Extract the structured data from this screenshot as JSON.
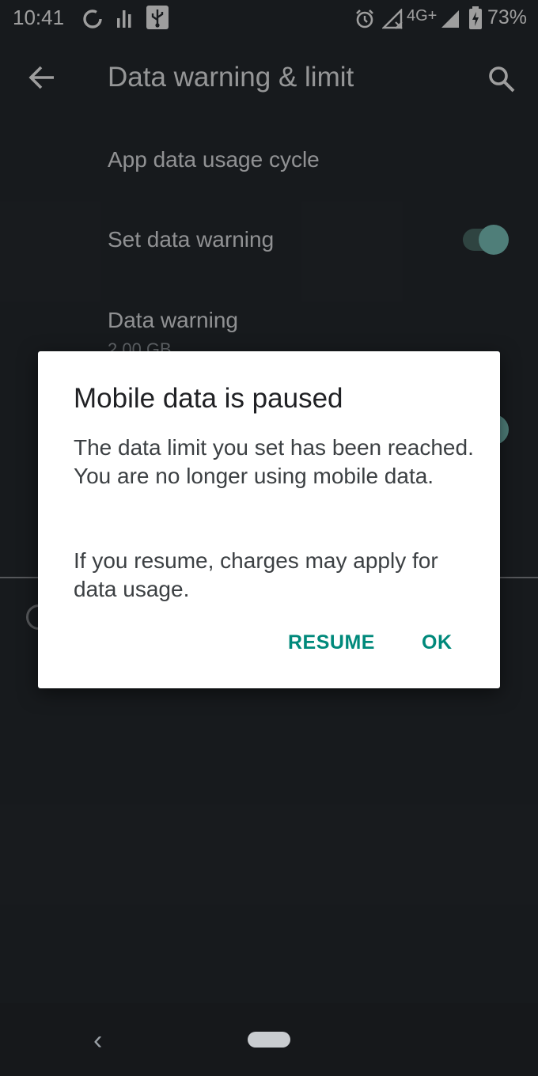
{
  "status_bar": {
    "time": "10:41",
    "network_type": "4G+",
    "battery_percent": "73%",
    "icons": [
      "sync-icon",
      "signal-bars-icon",
      "usb-icon",
      "alarm-icon",
      "no-signal-icon",
      "cell-signal-icon",
      "battery-charging-icon"
    ]
  },
  "app_bar": {
    "back_icon": "arrow-left-icon",
    "title": "Data warning & limit",
    "search_icon": "search-icon"
  },
  "settings": {
    "app_data_usage_cycle": "App data usage cycle",
    "set_data_warning": "Set data warning",
    "set_data_warning_enabled": true,
    "data_warning_title": "Data warning",
    "data_warning_value": "2.00 GB",
    "set_data_limit_enabled": true
  },
  "dialog": {
    "title": "Mobile data is paused",
    "message_1": "The data limit you set has been reached. You are no longer using mobile data.",
    "message_2": "If you resume, charges may apply for data usage.",
    "resume_label": "RESUME",
    "ok_label": "OK"
  },
  "nav_bar": {
    "back_glyph": "‹",
    "icons": [
      "nav-back-icon",
      "nav-home-pill-icon"
    ]
  },
  "colors": {
    "accent": "#00897b",
    "toggle_thumb": "#80cbc4",
    "background": "#262b30"
  }
}
